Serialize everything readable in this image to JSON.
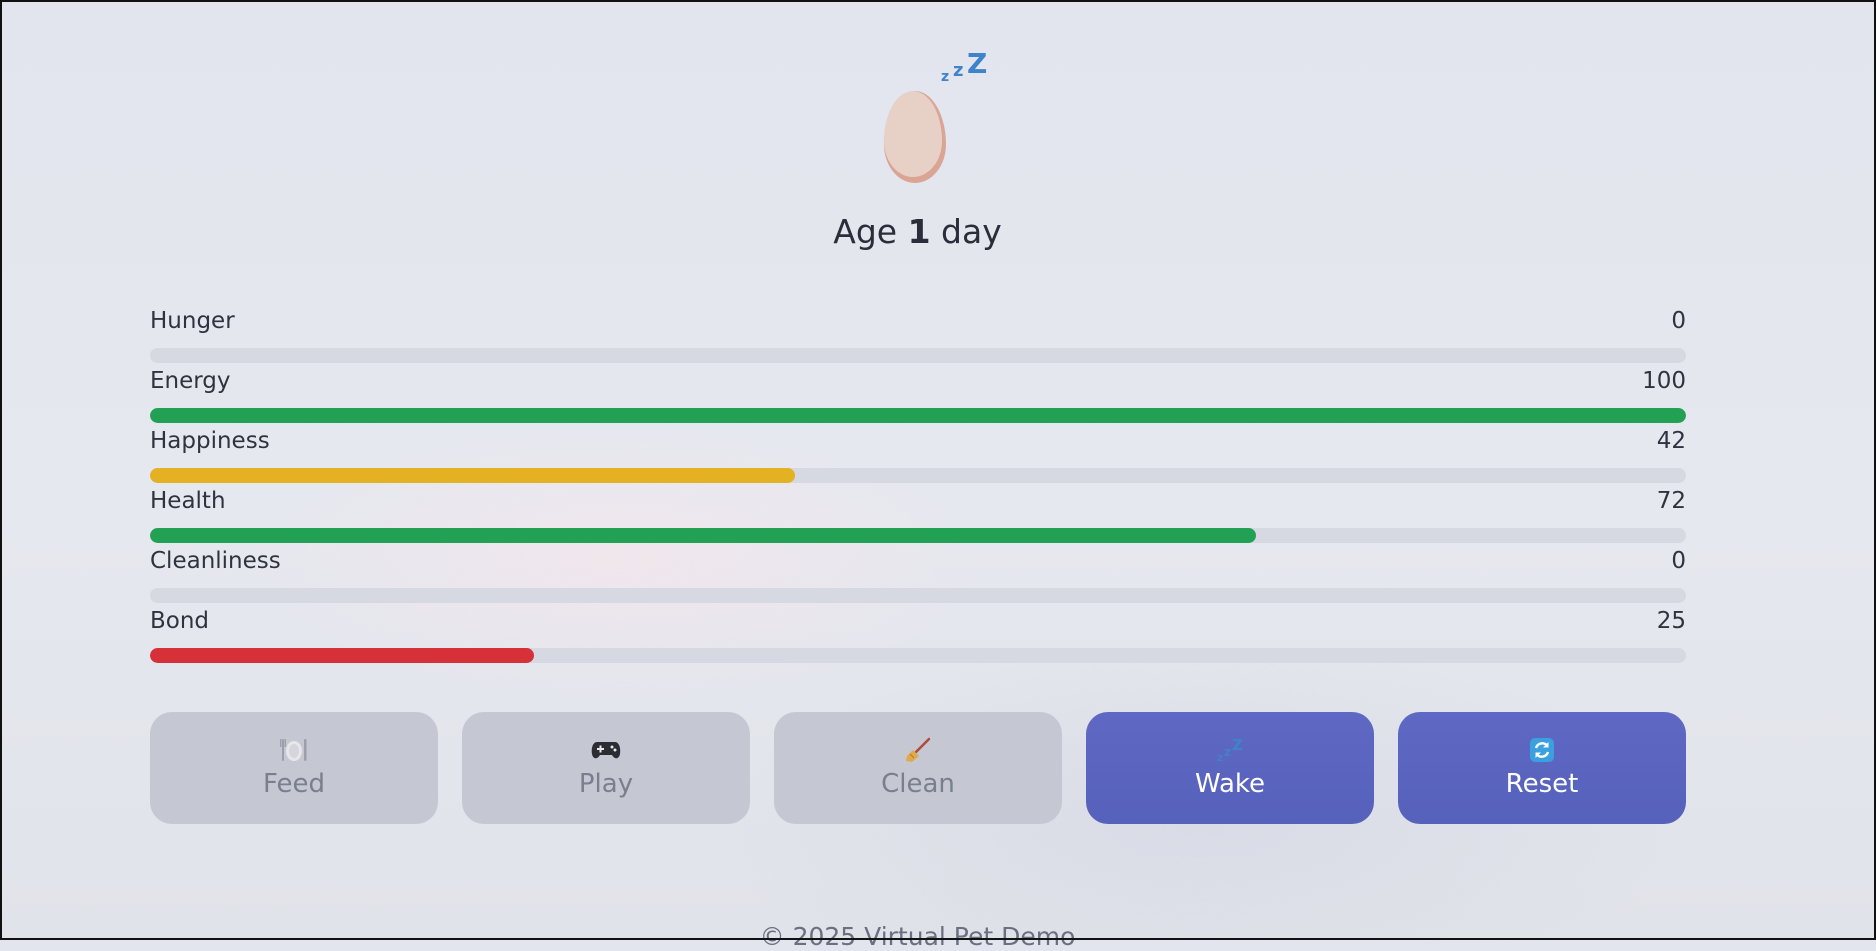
{
  "pet": {
    "sleep_icon": "sleeping-zzz-icon",
    "zzz": [
      "z",
      "z",
      "Z"
    ],
    "age_prefix": "Age",
    "age_value": "1",
    "age_suffix": "day"
  },
  "stats": [
    {
      "label": "Hunger",
      "value": "0",
      "fraction": 0.0,
      "color": "#2aa05a"
    },
    {
      "label": "Energy",
      "value": "100",
      "fraction": 1.0,
      "color": "#22a155"
    },
    {
      "label": "Happiness",
      "value": "42",
      "fraction": 0.42,
      "color": "#e3b122"
    },
    {
      "label": "Health",
      "value": "72",
      "fraction": 0.72,
      "color": "#22a155"
    },
    {
      "label": "Cleanliness",
      "value": "0",
      "fraction": 0.0,
      "color": "#2aa05a"
    },
    {
      "label": "Bond",
      "value": "25",
      "fraction": 0.25,
      "color": "#d63038"
    }
  ],
  "actions": [
    {
      "label": "Feed",
      "icon": "plate-cutlery-icon",
      "enabled": false
    },
    {
      "label": "Play",
      "icon": "gamepad-icon",
      "enabled": false
    },
    {
      "label": "Clean",
      "icon": "broom-icon",
      "enabled": false
    },
    {
      "label": "Wake",
      "icon": "zzz-icon",
      "enabled": true
    },
    {
      "label": "Reset",
      "icon": "reset-arrows-icon",
      "enabled": true
    }
  ],
  "footer": {
    "text": "© 2025 Virtual Pet Demo"
  }
}
